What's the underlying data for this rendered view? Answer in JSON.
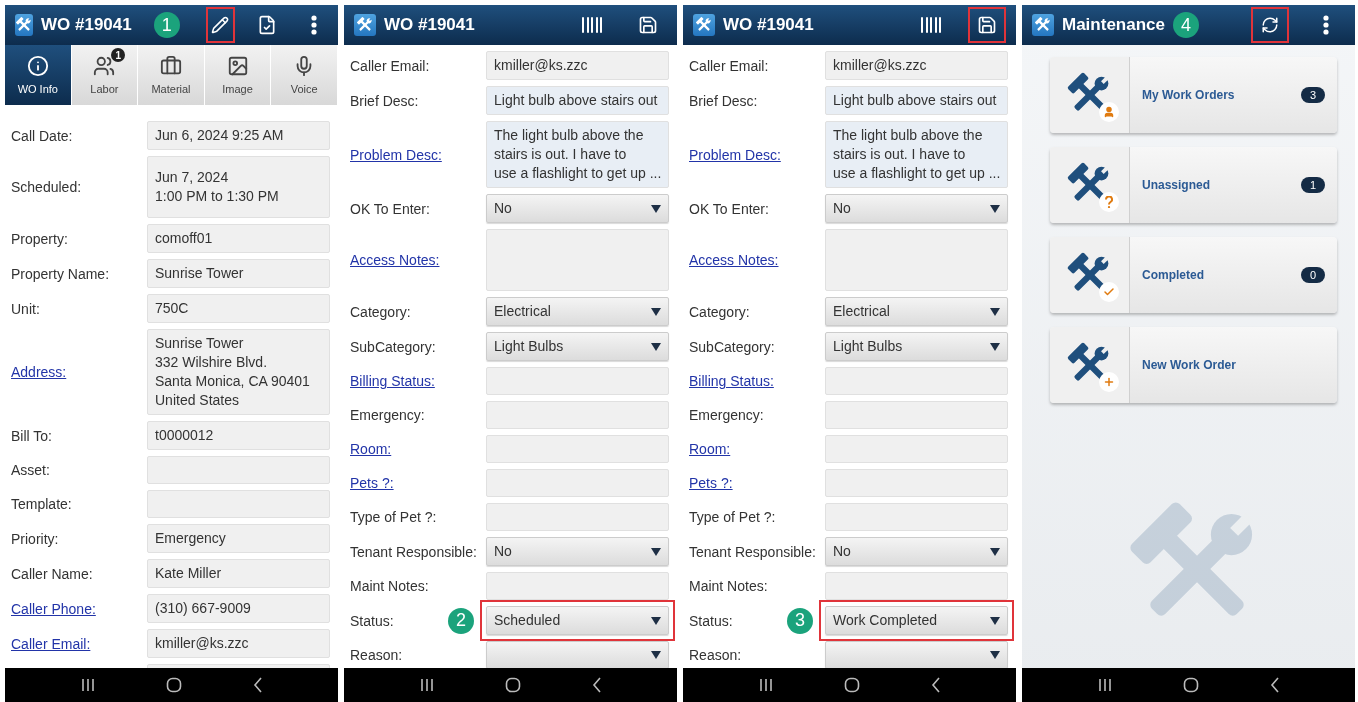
{
  "screens": [
    {
      "kind": "form",
      "title": "WO #19041",
      "callout": "1",
      "actions": [
        {
          "kind": "edit",
          "highlighted": true
        },
        {
          "kind": "document",
          "highlighted": false
        },
        {
          "kind": "more",
          "highlighted": false
        }
      ],
      "tabs": [
        {
          "label": "WO Info",
          "kind": "info",
          "selected": true
        },
        {
          "label": "Labor",
          "kind": "people",
          "badge": "1",
          "selected": false
        },
        {
          "label": "Material",
          "kind": "case",
          "selected": false
        },
        {
          "label": "Image",
          "kind": "image",
          "selected": false
        },
        {
          "label": "Voice",
          "kind": "mic",
          "selected": false
        }
      ],
      "fields": [
        {
          "label": "Call Date:",
          "kind": "text",
          "lines": [
            "Jun 6, 2024 9:25 AM"
          ]
        },
        {
          "label": "Scheduled:",
          "kind": "text",
          "lines": [
            "Jun 7, 2024",
            "1:00 PM to 1:30 PM"
          ]
        },
        {
          "label": "Property:",
          "kind": "text",
          "lines": [
            "comoff01"
          ]
        },
        {
          "label": "Property Name:",
          "kind": "text",
          "lines": [
            "Sunrise Tower"
          ]
        },
        {
          "label": "Unit:",
          "kind": "text",
          "lines": [
            "750C"
          ]
        },
        {
          "label": "Address:",
          "link": true,
          "kind": "text",
          "lines": [
            "Sunrise Tower",
            "332 Wilshire Blvd.",
            "Santa Monica, CA 90401",
            "United States"
          ]
        },
        {
          "label": "Bill To:",
          "kind": "text",
          "lines": [
            "t0000012"
          ]
        },
        {
          "label": "Asset:",
          "kind": "text"
        },
        {
          "label": "Template:",
          "kind": "text"
        },
        {
          "label": "Priority:",
          "kind": "text",
          "lines": [
            "Emergency"
          ]
        },
        {
          "label": "Caller Name:",
          "kind": "text",
          "lines": [
            "Kate Miller"
          ]
        },
        {
          "label": "Caller Phone:",
          "link": true,
          "kind": "text",
          "lines": [
            "(310) 667-9009"
          ]
        },
        {
          "label": "Caller Email:",
          "link": true,
          "kind": "text",
          "lines": [
            "kmiller@ks.zzc"
          ]
        },
        {
          "kind": "text"
        }
      ]
    },
    {
      "kind": "form",
      "title": "WO #19041",
      "actions": [
        {
          "kind": "barcode",
          "highlighted": false
        },
        {
          "kind": "save",
          "highlighted": false
        }
      ],
      "fields": [
        {
          "label": "Caller Email:",
          "kind": "text",
          "lines": [
            "kmiller@ks.zzc"
          ]
        },
        {
          "label": "Brief Desc:",
          "kind": "text",
          "tinted": true,
          "lines": [
            "Light bulb above stairs out"
          ]
        },
        {
          "label": "Problem Desc:",
          "link": true,
          "kind": "memo",
          "tinted": true,
          "lines": [
            "The light bulb above the",
            "stairs is out. I have to",
            "use a flashlight to get up ..."
          ]
        },
        {
          "label": "OK To Enter:",
          "kind": "select",
          "lines": [
            "No"
          ]
        },
        {
          "label": "Access Notes:",
          "link": true,
          "kind": "memo"
        },
        {
          "label": "Category:",
          "kind": "select",
          "tinted": true,
          "lines": [
            "Electrical"
          ]
        },
        {
          "label": "SubCategory:",
          "kind": "select",
          "tinted": true,
          "lines": [
            "Light Bulbs"
          ]
        },
        {
          "label": "Billing Status:",
          "link": true,
          "kind": "text"
        },
        {
          "label": "Emergency:",
          "kind": "text"
        },
        {
          "label": "Room:",
          "link": true,
          "kind": "text"
        },
        {
          "label": "Pets ?:",
          "link": true,
          "kind": "text"
        },
        {
          "label": "Type of Pet ?:",
          "kind": "text"
        },
        {
          "label": "Tenant Responsible:",
          "kind": "select",
          "lines": [
            "No"
          ]
        },
        {
          "label": "Maint Notes:",
          "kind": "text"
        },
        {
          "label": "Status:",
          "kind": "select",
          "callout": "2",
          "highlighted": true,
          "lines": [
            "Scheduled"
          ]
        },
        {
          "label": "Reason:",
          "kind": "select"
        }
      ]
    },
    {
      "kind": "form",
      "title": "WO #19041",
      "actions": [
        {
          "kind": "barcode",
          "highlighted": false
        },
        {
          "kind": "save",
          "highlighted": true
        }
      ],
      "fields": [
        {
          "label": "Caller Email:",
          "kind": "text",
          "lines": [
            "kmiller@ks.zzc"
          ]
        },
        {
          "label": "Brief Desc:",
          "kind": "text",
          "tinted": true,
          "lines": [
            "Light bulb above stairs out"
          ]
        },
        {
          "label": "Problem Desc:",
          "link": true,
          "kind": "memo",
          "tinted": true,
          "lines": [
            "The light bulb above the",
            "stairs is out. I have to",
            "use a flashlight to get up ..."
          ]
        },
        {
          "label": "OK To Enter:",
          "kind": "select",
          "lines": [
            "No"
          ]
        },
        {
          "label": "Access Notes:",
          "link": true,
          "kind": "memo"
        },
        {
          "label": "Category:",
          "kind": "select",
          "tinted": true,
          "lines": [
            "Electrical"
          ]
        },
        {
          "label": "SubCategory:",
          "kind": "select",
          "tinted": true,
          "lines": [
            "Light Bulbs"
          ]
        },
        {
          "label": "Billing Status:",
          "link": true,
          "kind": "text"
        },
        {
          "label": "Emergency:",
          "kind": "text"
        },
        {
          "label": "Room:",
          "link": true,
          "kind": "text"
        },
        {
          "label": "Pets ?:",
          "link": true,
          "kind": "text"
        },
        {
          "label": "Type of Pet ?:",
          "kind": "text"
        },
        {
          "label": "Tenant Responsible:",
          "kind": "select",
          "lines": [
            "No"
          ]
        },
        {
          "label": "Maint Notes:",
          "kind": "text"
        },
        {
          "label": "Status:",
          "kind": "select",
          "callout": "3",
          "highlighted": true,
          "lines": [
            "Work Completed"
          ]
        },
        {
          "label": "Reason:",
          "kind": "select"
        }
      ]
    },
    {
      "kind": "menu",
      "title": "Maintenance",
      "callout": "4",
      "actions": [
        {
          "kind": "refresh",
          "highlighted": true
        },
        {
          "kind": "more",
          "highlighted": false
        }
      ],
      "items": [
        {
          "label": "My Work Orders",
          "count": "3",
          "kind": "person"
        },
        {
          "label": "Unassigned",
          "count": "1",
          "kind": "question"
        },
        {
          "label": "Completed",
          "count": "0",
          "kind": "check"
        },
        {
          "label": "New Work Order",
          "kind": "plus"
        }
      ]
    }
  ]
}
